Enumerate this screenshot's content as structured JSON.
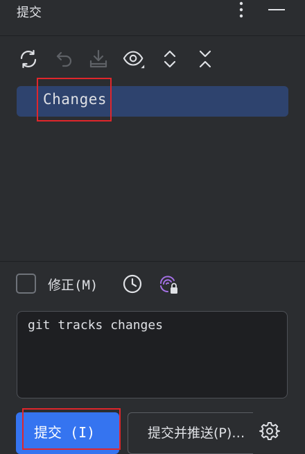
{
  "header": {
    "title": "提交",
    "more_icon": "more-vertical-icon",
    "minimize_icon": "minimize-icon"
  },
  "toolbar": {
    "icons": [
      "refresh-icon",
      "rollback-icon",
      "shelve-icon",
      "view-options-icon",
      "expand-all-icon",
      "collapse-all-icon"
    ]
  },
  "tree": {
    "root_label": "Changes"
  },
  "options": {
    "amend_label": "修正(M)",
    "amend_checked": false,
    "history_icon": "clock-icon",
    "ai_icon": "ai-assistant-lock-icon"
  },
  "message": {
    "text": "git tracks changes"
  },
  "actions": {
    "commit_label": "提交 (I)",
    "commit_push_label": "提交并推送(P)…",
    "settings_icon": "gear-icon"
  },
  "colors": {
    "background": "#2b2d30",
    "selection": "#2e436e",
    "primary_button": "#3574f0",
    "highlight_box": "#e0262b",
    "ai_icon": "#a571e6"
  }
}
